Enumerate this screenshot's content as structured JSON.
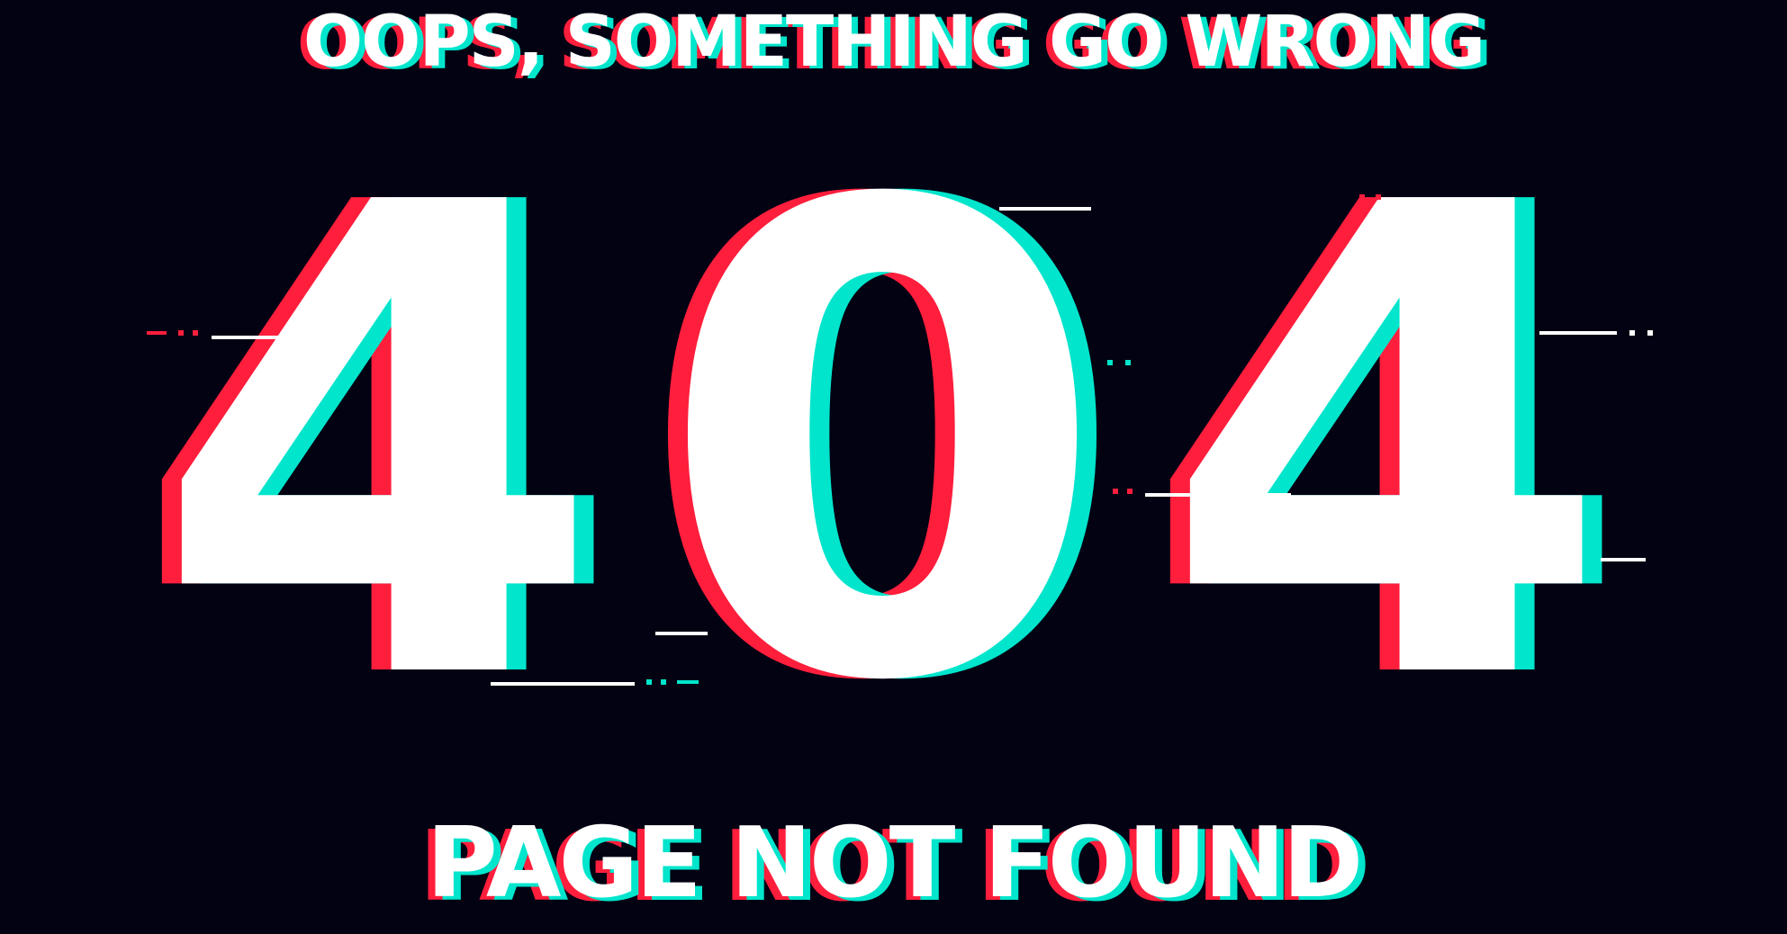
{
  "headline": "OOPS, SOMETHING GO WRONG",
  "error_code": {
    "digit_1": "4",
    "digit_2": "0",
    "digit_3": "4"
  },
  "footer": "PAGE NOT FOUND",
  "colors": {
    "background": "#020213",
    "text": "#ffffff",
    "glitch_red": "#ff1e3c",
    "glitch_cyan": "#00e5cc"
  }
}
